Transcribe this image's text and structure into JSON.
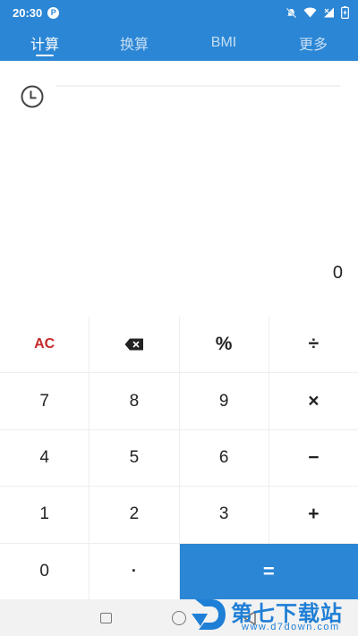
{
  "status_bar": {
    "time": "20:30",
    "app_badge": "P",
    "icons": [
      "dnd-off-icon",
      "wifi-icon",
      "signal-icon",
      "battery-charging-icon"
    ]
  },
  "tabs": [
    {
      "label": "计算",
      "active": true
    },
    {
      "label": "换算",
      "active": false
    },
    {
      "label": "BMI",
      "active": false
    },
    {
      "label": "更多",
      "active": false
    }
  ],
  "display": {
    "history_icon": "clock-icon",
    "result": "0"
  },
  "keypad": {
    "clear": "AC",
    "backspace_icon": "backspace-icon",
    "percent": "%",
    "divide": "÷",
    "seven": "7",
    "eight": "8",
    "nine": "9",
    "multiply": "×",
    "four": "4",
    "five": "5",
    "six": "6",
    "minus": "−",
    "one": "1",
    "two": "2",
    "three": "3",
    "plus": "+",
    "zero": "0",
    "dot": "·",
    "equals": "="
  },
  "navigation": {
    "recents_icon": "square-icon",
    "home_icon": "circle-icon",
    "back_icon": "back-triangle-icon"
  },
  "watermark": {
    "title": "第七下载站",
    "url": "www.d7down.com"
  },
  "colors": {
    "primary": "#2b86d5",
    "clear_key": "#c62828",
    "key_background": "#ffffff",
    "grid_line": "#eeeeee"
  }
}
